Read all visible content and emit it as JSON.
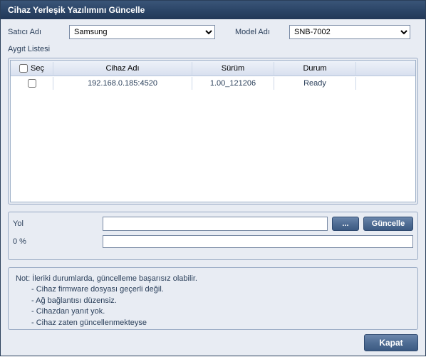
{
  "window": {
    "title": "Cihaz Yerleşik Yazılımını Güncelle"
  },
  "filters": {
    "vendor_label": "Satıcı Adı",
    "vendor_value": "Samsung",
    "model_label": "Model Adı",
    "model_value": "SNB-7002"
  },
  "device_list": {
    "title": "Aygıt Listesi",
    "columns": {
      "select": "Seç",
      "name": "Cihaz Adı",
      "version": "Sürüm",
      "status": "Durum"
    },
    "rows": [
      {
        "checked": false,
        "name": "192.168.0.185:4520",
        "version": "1.00_121206",
        "status": "Ready"
      }
    ]
  },
  "path": {
    "label": "Yol",
    "value": "",
    "browse_label": "...",
    "update_label": "Güncelle"
  },
  "progress": {
    "label": "0 %",
    "value": 0
  },
  "note": {
    "prefix": "Not:",
    "heading": "İleriki durumlarda, güncelleme başarısız olabilir.",
    "lines": [
      "- Cihaz firmware dosyası geçerli değil.",
      "- Ağ bağlantısı düzensiz.",
      "- Cihazdan yanıt yok.",
      "- Cihaz zaten güncellenmekteyse"
    ]
  },
  "buttons": {
    "close": "Kapat"
  }
}
